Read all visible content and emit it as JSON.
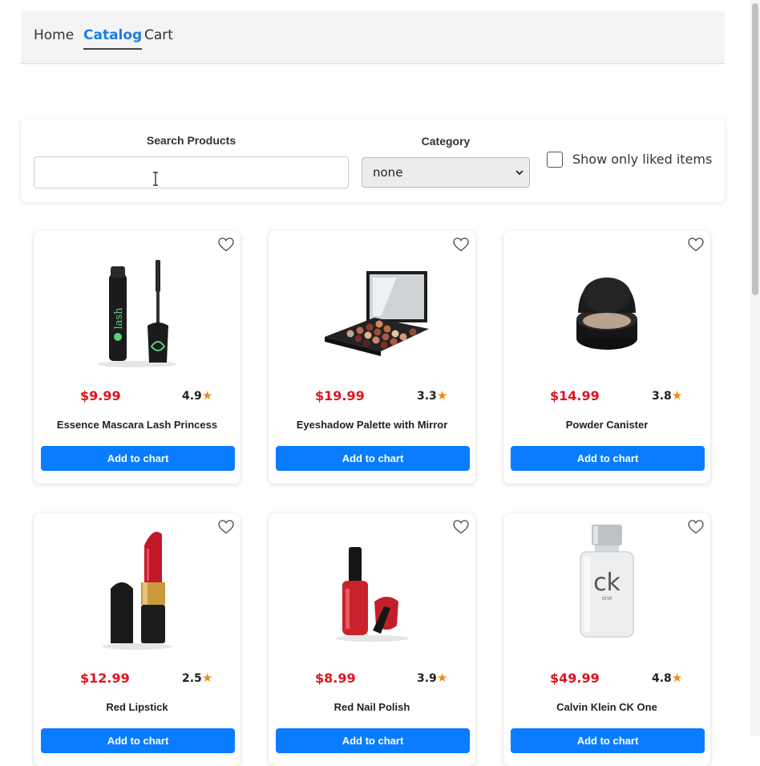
{
  "nav": {
    "home": "Home",
    "catalog": "Catalog",
    "cart": "Cart"
  },
  "filters": {
    "search_label": "Search Products",
    "search_value": "",
    "category_label": "Category",
    "category_value": "none",
    "liked_label": "Show only liked items",
    "liked_checked": false
  },
  "products": [
    {
      "name": "Essence Mascara Lash Princess",
      "price": "$9.99",
      "rating": "4.9",
      "button": "Add to chart",
      "liked": false
    },
    {
      "name": "Eyeshadow Palette with Mirror",
      "price": "$19.99",
      "rating": "3.3",
      "button": "Add to chart",
      "liked": false
    },
    {
      "name": "Powder Canister",
      "price": "$14.99",
      "rating": "3.8",
      "button": "Add to chart",
      "liked": false
    },
    {
      "name": "Red Lipstick",
      "price": "$12.99",
      "rating": "2.5",
      "button": "Add to chart",
      "liked": false
    },
    {
      "name": "Red Nail Polish",
      "price": "$8.99",
      "rating": "3.9",
      "button": "Add to chart",
      "liked": false
    },
    {
      "name": "Calvin Klein CK One",
      "price": "$49.99",
      "rating": "4.8",
      "button": "Add to chart",
      "liked": false
    }
  ],
  "colors": {
    "accent": "#1a7ee8",
    "button": "#0a7cff",
    "price": "#e0141e",
    "star": "#f08a12"
  },
  "icons": {
    "heart": "heart-outline-icon",
    "star": "star-icon",
    "chevron": "chevron-down-icon"
  }
}
